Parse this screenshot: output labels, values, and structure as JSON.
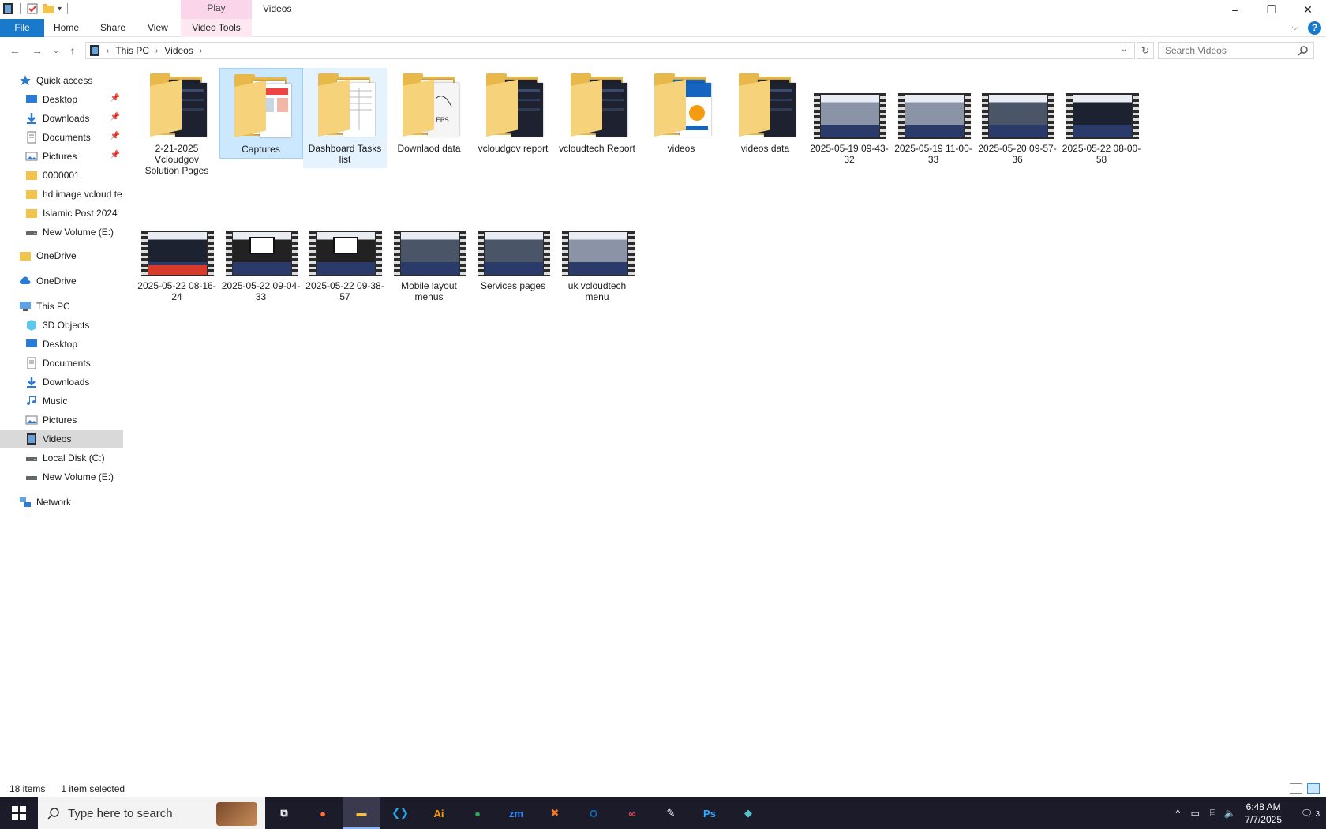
{
  "window": {
    "title": "Videos",
    "context_tab": "Play",
    "controls": [
      "–",
      "❐",
      "✕"
    ]
  },
  "ribbon": {
    "tabs": [
      "File",
      "Home",
      "Share",
      "View",
      "Video Tools"
    ],
    "help": "?"
  },
  "address": {
    "crumbs": [
      "This PC",
      "Videos"
    ],
    "search_placeholder": "Search Videos"
  },
  "sidebar": {
    "items": [
      {
        "label": "Quick access",
        "icon": "star-icon",
        "indent": 0,
        "pinned": false
      },
      {
        "label": "Desktop",
        "icon": "desktop-icon",
        "indent": 1,
        "pinned": true
      },
      {
        "label": "Downloads",
        "icon": "download-icon",
        "indent": 1,
        "pinned": true
      },
      {
        "label": "Documents",
        "icon": "documents-icon",
        "indent": 1,
        "pinned": true
      },
      {
        "label": "Pictures",
        "icon": "pictures-icon",
        "indent": 1,
        "pinned": true
      },
      {
        "label": "0000001",
        "icon": "folder-icon",
        "indent": 1,
        "pinned": false
      },
      {
        "label": "hd image vcloud te",
        "icon": "folder-icon",
        "indent": 1,
        "pinned": false
      },
      {
        "label": "Islamic Post 2024",
        "icon": "folder-icon",
        "indent": 1,
        "pinned": false
      },
      {
        "label": "New Volume (E:)",
        "icon": "drive-icon",
        "indent": 1,
        "pinned": false
      },
      {
        "label": "OneDrive",
        "icon": "folder-icon",
        "indent": 0,
        "pinned": false
      },
      {
        "label": "OneDrive",
        "icon": "cloud-icon",
        "indent": 0,
        "pinned": false
      },
      {
        "label": "This PC",
        "icon": "computer-icon",
        "indent": 0,
        "pinned": false
      },
      {
        "label": "3D Objects",
        "icon": "cube-icon",
        "indent": 1,
        "pinned": false
      },
      {
        "label": "Desktop",
        "icon": "desktop-icon",
        "indent": 1,
        "pinned": false
      },
      {
        "label": "Documents",
        "icon": "documents-icon",
        "indent": 1,
        "pinned": false
      },
      {
        "label": "Downloads",
        "icon": "download-icon",
        "indent": 1,
        "pinned": false
      },
      {
        "label": "Music",
        "icon": "music-icon",
        "indent": 1,
        "pinned": false
      },
      {
        "label": "Pictures",
        "icon": "pictures-icon",
        "indent": 1,
        "pinned": false
      },
      {
        "label": "Videos",
        "icon": "video-icon",
        "indent": 1,
        "pinned": false,
        "selected": true
      },
      {
        "label": "Local Disk (C:)",
        "icon": "drive-icon",
        "indent": 1,
        "pinned": false
      },
      {
        "label": "New Volume (E:)",
        "icon": "drive-icon",
        "indent": 1,
        "pinned": false
      },
      {
        "label": "Network",
        "icon": "network-icon",
        "indent": 0,
        "pinned": false
      }
    ]
  },
  "files": [
    {
      "label": "2-21-2025 Vcloudgov Solution Pages",
      "kind": "folder",
      "doc": "dark"
    },
    {
      "label": "Captures",
      "kind": "folder",
      "doc": "web",
      "state": "selected"
    },
    {
      "label": "Dashboard Tasks list",
      "kind": "folder",
      "doc": "sheet",
      "state": "hover"
    },
    {
      "label": "Downlaod data",
      "kind": "folder",
      "doc": "eps"
    },
    {
      "label": "vcloudgov report",
      "kind": "folder",
      "doc": "dark"
    },
    {
      "label": "vcloudtech Report",
      "kind": "folder",
      "doc": "dark"
    },
    {
      "label": "videos",
      "kind": "folder",
      "doc": "poster"
    },
    {
      "label": "videos data",
      "kind": "folder",
      "doc": "dark"
    },
    {
      "label": "2025-05-19 09-43-32",
      "kind": "video",
      "frame": "light"
    },
    {
      "label": "2025-05-19 11-00-33",
      "kind": "video",
      "frame": "light"
    },
    {
      "label": "2025-05-20 09-57-36",
      "kind": "video",
      "frame": "mid"
    },
    {
      "label": "2025-05-22 08-00-58",
      "kind": "video",
      "frame": "dark"
    },
    {
      "label": "2025-05-22 08-16-24",
      "kind": "video",
      "frame": "red"
    },
    {
      "label": "2025-05-22 09-04-33",
      "kind": "video",
      "frame": "dialog"
    },
    {
      "label": "2025-05-22 09-38-57",
      "kind": "video",
      "frame": "dialog"
    },
    {
      "label": "Mobile layout menus",
      "kind": "video",
      "frame": "mid"
    },
    {
      "label": "Services pages",
      "kind": "video",
      "frame": "mid"
    },
    {
      "label": "uk vcloudtech menu",
      "kind": "video",
      "frame": "light"
    }
  ],
  "status": {
    "count": "18 items",
    "selection": "1 item selected"
  },
  "taskbar": {
    "search_placeholder": "Type here to search",
    "apps": [
      {
        "name": "task-view",
        "glyph": "⧉"
      },
      {
        "name": "firefox",
        "glyph": "●",
        "color": "#ff7139"
      },
      {
        "name": "file-explorer",
        "glyph": "▬",
        "color": "#f3c34b",
        "active": true
      },
      {
        "name": "vscode",
        "glyph": "❮❯",
        "color": "#23a9f2"
      },
      {
        "name": "illustrator",
        "glyph": "Ai",
        "color": "#ff9a00"
      },
      {
        "name": "chrome",
        "glyph": "●",
        "color": "#34a853"
      },
      {
        "name": "zoom",
        "glyph": "zm",
        "color": "#2d8cff"
      },
      {
        "name": "xampp",
        "glyph": "✖",
        "color": "#fb7a24"
      },
      {
        "name": "outlook",
        "glyph": "O",
        "color": "#0f6cbd"
      },
      {
        "name": "creative-cloud",
        "glyph": "∞",
        "color": "#e34850"
      },
      {
        "name": "pen-tool",
        "glyph": "✎",
        "color": "#ffffff"
      },
      {
        "name": "photoshop",
        "glyph": "Ps",
        "color": "#31a8ff"
      },
      {
        "name": "app-diamond",
        "glyph": "◆",
        "color": "#4fc3c7"
      }
    ],
    "time": "6:48 AM",
    "date": "7/7/2025",
    "notifications": "3"
  },
  "colors": {
    "accent": "#1979ca",
    "selection": "#cce8ff",
    "folder": "#e8b84a",
    "taskbar": "#1b1b2a"
  }
}
